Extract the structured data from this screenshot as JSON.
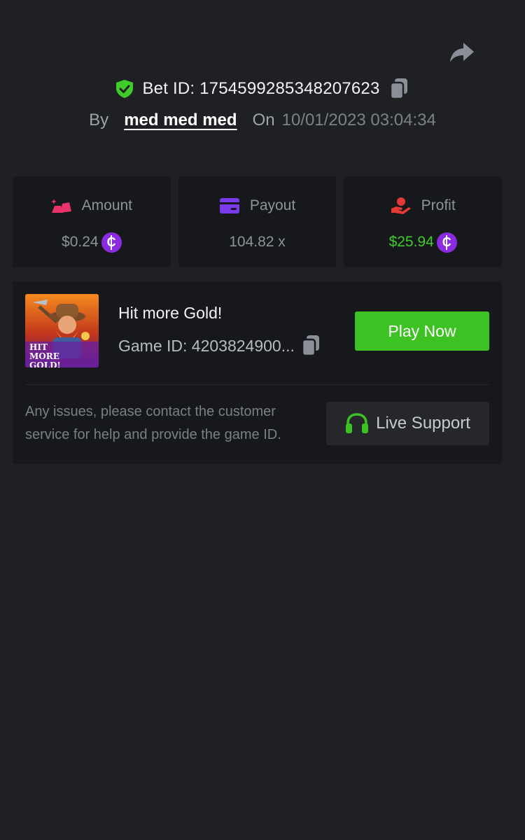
{
  "header": {
    "share_icon": "share-forward-icon",
    "bet_id_label": "Bet ID: 1754599285348207623",
    "by_label": "By",
    "username": "med med med",
    "on_label": "On",
    "datetime": "10/01/2023 03:04:34"
  },
  "stats": {
    "amount": {
      "label": "Amount",
      "value": "$0.24",
      "icon": "gold-bars-icon",
      "icon_color": "#e8336d"
    },
    "payout": {
      "label": "Payout",
      "value": "104.82 x",
      "icon": "credit-card-icon",
      "icon_color": "#7c3aed"
    },
    "profit": {
      "label": "Profit",
      "value": "$25.94",
      "icon": "hand-money-icon",
      "icon_color": "#e53935",
      "value_color": "#3fcb29"
    },
    "currency_icon": "coin-icon",
    "currency_color": "#8a2be2"
  },
  "game": {
    "title": "Hit more Gold!",
    "game_id": "Game ID: 4203824900...",
    "thumbnail_text": "HIT MORE GOLD!",
    "play_button": "Play Now"
  },
  "support": {
    "help_text": "Any issues, please contact the customer service for help and provide the game ID.",
    "button_label": "Live Support",
    "icon": "headset-icon"
  },
  "colors": {
    "background": "#1f2024",
    "card": "#17181b",
    "accent_green": "#3dc223",
    "verified_green": "#3fcb29"
  }
}
